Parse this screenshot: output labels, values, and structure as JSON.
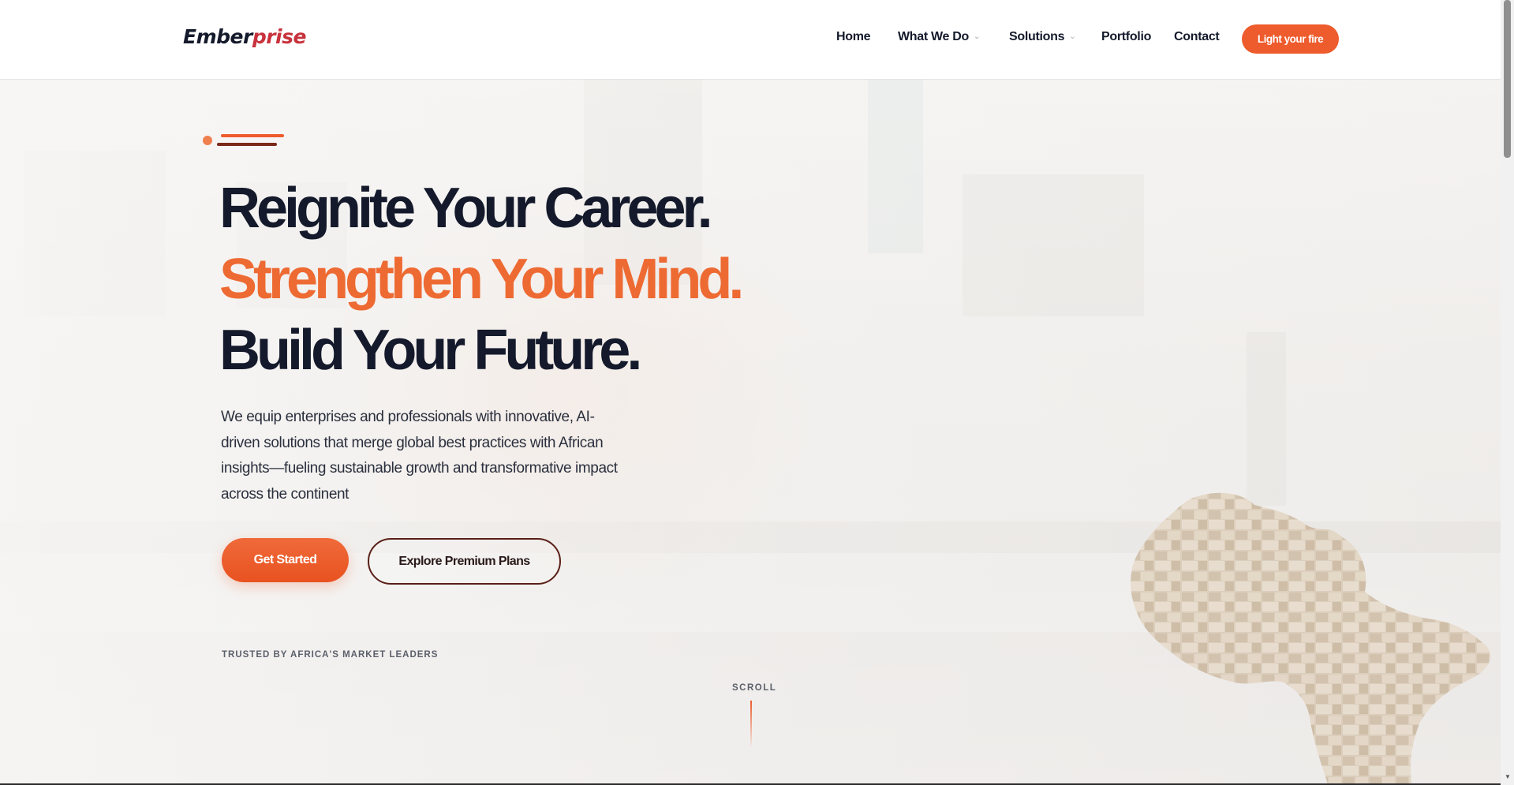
{
  "header": {
    "logo_part1": "Ember",
    "logo_part2": "prise",
    "nav": [
      {
        "label": "Home"
      },
      {
        "label": "What We Do",
        "has_dropdown": true
      },
      {
        "label": "Solutions",
        "has_dropdown": true
      },
      {
        "label": "Portfolio"
      },
      {
        "label": "Contact"
      }
    ],
    "cta_label": "Light your fire"
  },
  "hero": {
    "line1": "Reignite Your Career.",
    "line2": "Strengthen Your Mind.",
    "line3": "Build Your Future.",
    "lead": "We equip enterprises and professionals with innovative, AI-driven solutions that merge global best practices with African insights—fueling sustainable growth and transformative impact across the continent",
    "primary_button": "Get Started",
    "secondary_button": "Explore Premium Plans",
    "trusted_label": "TRUSTED BY AFRICA'S MARKET LEADERS",
    "scroll_label": "SCROLL"
  },
  "colors": {
    "accent": "#ee5b2c",
    "dark": "#141a2b",
    "outline": "#5a1f18"
  },
  "icons": [
    "chevron-down-icon",
    "africa-map-graphic"
  ]
}
